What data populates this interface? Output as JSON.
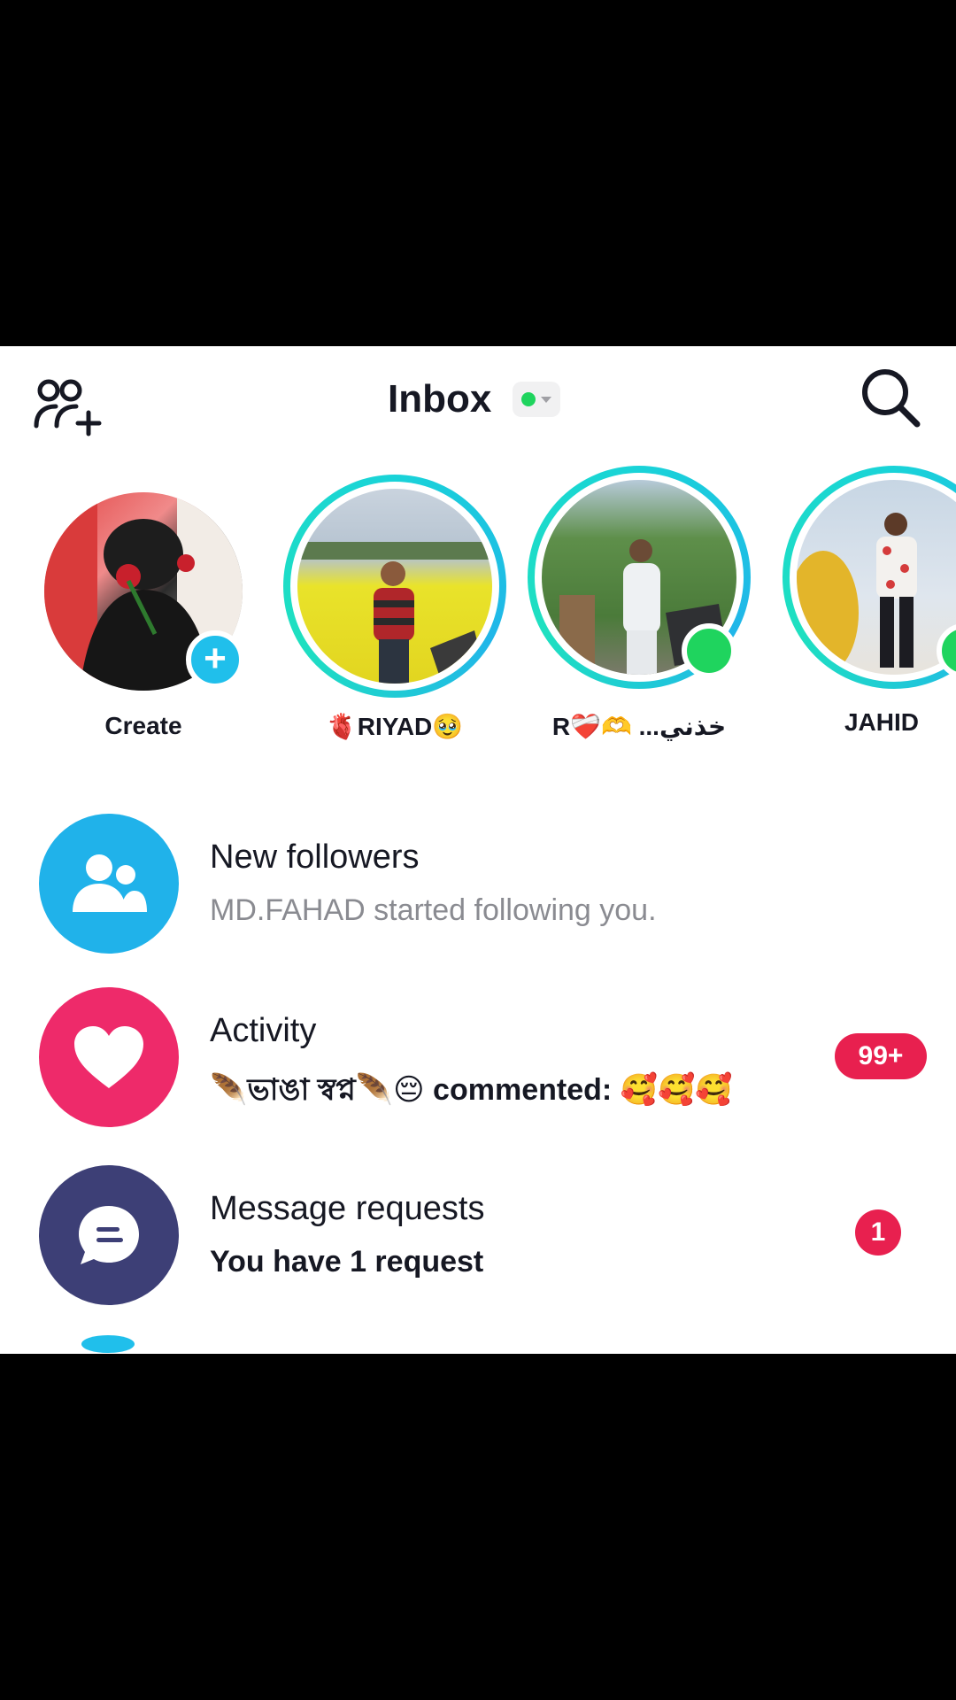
{
  "header": {
    "title": "Inbox",
    "add_friends_icon": "add-friends-icon",
    "search_icon": "search-icon",
    "status_color": "#1fd45e"
  },
  "stories": [
    {
      "label": "Create",
      "type": "create"
    },
    {
      "label": "🫀RIYAD🥹",
      "type": "story"
    },
    {
      "label": "R❤️‍🩹🫶 ...خذني",
      "type": "story",
      "online": true
    },
    {
      "label": "JAHID",
      "type": "story"
    }
  ],
  "rows": {
    "followers": {
      "title": "New followers",
      "subtitle": "MD.FAHAD started following you.",
      "icon": "people-icon",
      "color": "#20b2ea"
    },
    "activity": {
      "title": "Activity",
      "subtitle": "🪶ভাঙা স্বপ্ন🪶😔 commented: 🥰🥰🥰",
      "badge": "99+",
      "icon": "heart-icon",
      "color": "#ee2a6a"
    },
    "requests": {
      "title": "Message requests",
      "subtitle": "You have 1 request",
      "badge": "1",
      "icon": "message-bubble-icon",
      "color": "#3d3f76"
    }
  },
  "colors": {
    "accent": "#20bfeb",
    "badge": "#e8204f",
    "online": "#1fd45e"
  }
}
